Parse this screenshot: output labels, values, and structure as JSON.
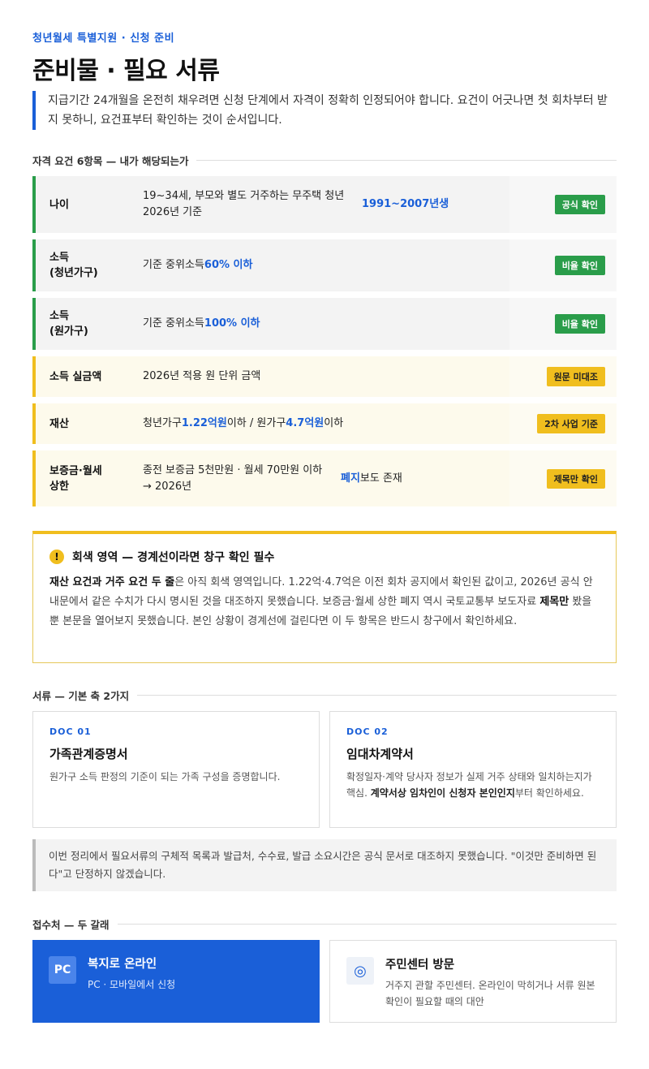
{
  "header": {
    "eyebrow": "청년월세 특별지원 · 신청 준비",
    "title": "준비물 · 필요 서류",
    "lead": "지급기간 24개월을 온전히 채우려면 신청 단계에서 자격이 정확히 인정되어야 합니다. 요건이 어긋나면 첫 회차부터 받지 못하니, 요건표부터 확인하는 것이 순서입니다."
  },
  "requirements": {
    "section_title": "자격 요건 6항목 — 내가 해당되는가",
    "rows": [
      {
        "label": "나이",
        "value_a": "19~34세, 부모와 별도 거주하는 무주택 청년",
        "value_b": "2026년 기준",
        "highlight": "1991~2007년생",
        "badge": "공식 확인",
        "status": "green"
      },
      {
        "label": "소득",
        "label_2": "(청년가구)",
        "value_a": "기준 중위소득",
        "highlight": "60% 이하",
        "badge": "비율 확인",
        "status": "green"
      },
      {
        "label": "소득",
        "label_2": "(원가구)",
        "value_a": "기준 중위소득",
        "highlight": "100% 이하",
        "badge": "비율 확인",
        "status": "green"
      },
      {
        "label": "소득 실금액",
        "value_a": "2026년 적용 원 단위 금액",
        "badge": "원문 미대조",
        "status": "yellow"
      },
      {
        "label": "재산",
        "value_a": "청년가구",
        "hl_1": "1.22억원",
        "value_b": "이하 / 원가구",
        "hl_2": "4.7억원",
        "value_c": "이하",
        "badge": "2차 사업 기준",
        "status": "yellow"
      },
      {
        "label": "보증금·월세",
        "label_2": "상한",
        "value_a": "종전 보증금 5천만원 · 월세 70만원 이하",
        "value_b": "→ 2026년",
        "highlight": "폐지",
        "value_c": "보도 존재",
        "badge": "제목만 확인",
        "status": "yellow"
      }
    ]
  },
  "notice": {
    "icon": "!",
    "title": "회색 영역 — 경계선이라면 창구 확인 필수",
    "bold_1": "재산 요건과 거주 요건 두 줄",
    "text_1": "은 아직 회색 영역입니다. 1.22억·4.7억은 이전 회차 공지에서 확인된 값이고, 2026년 공식 안내문에서 같은 수치가 다시 명시된 것을 대조하지 못했습니다. 보증금·월세 상한 폐지 역시 국토교통부 보도자료 ",
    "bold_2": "제목만",
    "text_2": " 봤을 뿐 본문을 열어보지 못했습니다. 본인 상황이 경계선에 걸린다면 이 두 항목은 반드시 창구에서 확인하세요."
  },
  "documents": {
    "section_title": "서류 — 기본 축 2가지",
    "items": [
      {
        "code": "DOC 01",
        "title": "가족관계증명서",
        "desc": "원가구 소득 판정의 기준이 되는 가족 구성을 증명합니다."
      },
      {
        "code": "DOC 02",
        "title": "임대차계약서",
        "desc_a": "확정일자·계약 당사자 정보가 실제 거주 상태와 일치하는지가 핵심. ",
        "desc_bold": "계약서상 임차인이 신청자 본인인지",
        "desc_b": "부터 확인하세요."
      }
    ],
    "disclaimer": "이번 정리에서 필요서류의 구체적 목록과 발급처, 수수료, 발급 소요시간은 공식 문서로 대조하지 못했습니다. \"이것만 준비하면 된다\"고 단정하지 않겠습니다."
  },
  "channels": {
    "section_title": "접수처 — 두 갈래",
    "items": [
      {
        "icon_text": "PC",
        "icon": "pc-icon",
        "title": "복지로 온라인",
        "desc": "PC · 모바일에서 신청"
      },
      {
        "icon_text": "◎",
        "icon": "target-icon",
        "title": "주민센터 방문",
        "desc": "거주지 관할 주민센터. 온라인이 막히거나 서류 원본 확인이 필요할 때의 대안"
      }
    ]
  },
  "colors": {
    "accent": "#1a5fd8",
    "confirmed": "#2a9d4a",
    "caution": "#f0be1e"
  }
}
